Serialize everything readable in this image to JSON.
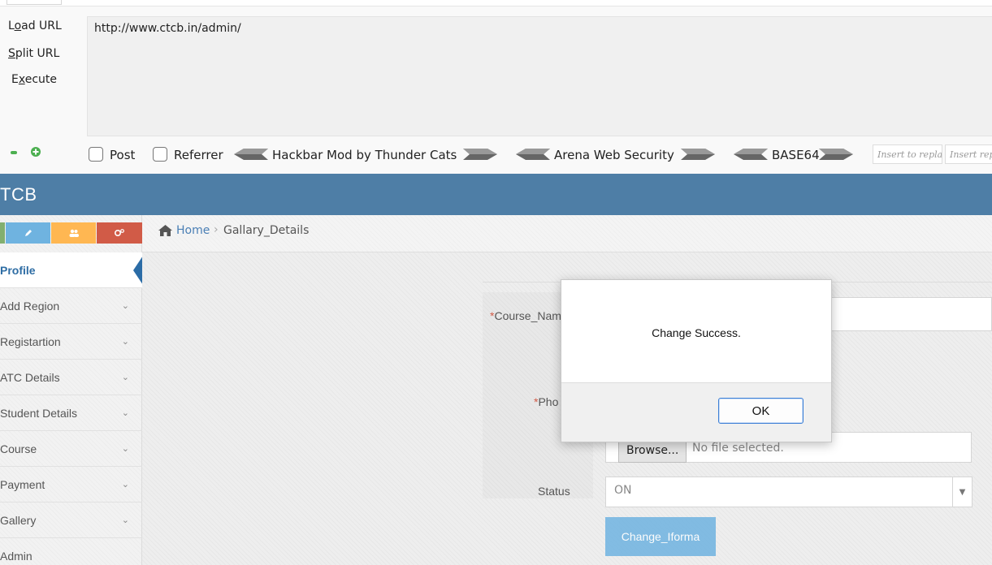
{
  "hackbar": {
    "load_url": "Load URL",
    "split_url": "Split URL",
    "execute": "Execute",
    "url": "http://www.ctcb.in/admin/",
    "post_label": "Post",
    "referrer_label": "Referrer",
    "groups": [
      "Hackbar Mod by Thunder Cats",
      "Arena Web Security",
      "BASE64"
    ],
    "insert_replace_placeholder": "Insert to replace",
    "insert_replace_with_placeholder": "Insert replacing"
  },
  "header": {
    "brand": "TCB"
  },
  "sidebar": {
    "items": [
      {
        "label": "Profile",
        "active": true
      },
      {
        "label": "Add Region"
      },
      {
        "label": "Registartion"
      },
      {
        "label": "ATC Details"
      },
      {
        "label": "Student Details"
      },
      {
        "label": "Course"
      },
      {
        "label": "Payment"
      },
      {
        "label": "Gallery"
      },
      {
        "label": "Admin"
      }
    ]
  },
  "breadcrumb": {
    "home": "Home",
    "current": "Gallary_Details"
  },
  "form": {
    "course_name_label": "Course_Nam",
    "photo_label": "Pho",
    "browse_button": "Browse...",
    "file_status": "No file selected.",
    "status_label": "Status",
    "status_value": "ON",
    "submit_label": "Change_Iforma"
  },
  "dialog": {
    "message": "Change Success.",
    "ok_label": "OK"
  },
  "colors": {
    "header_bg": "#4e7ea6",
    "accent_link": "#4a7fb5",
    "required": "#d15b47",
    "submit_bg": "#6fb3e0"
  }
}
